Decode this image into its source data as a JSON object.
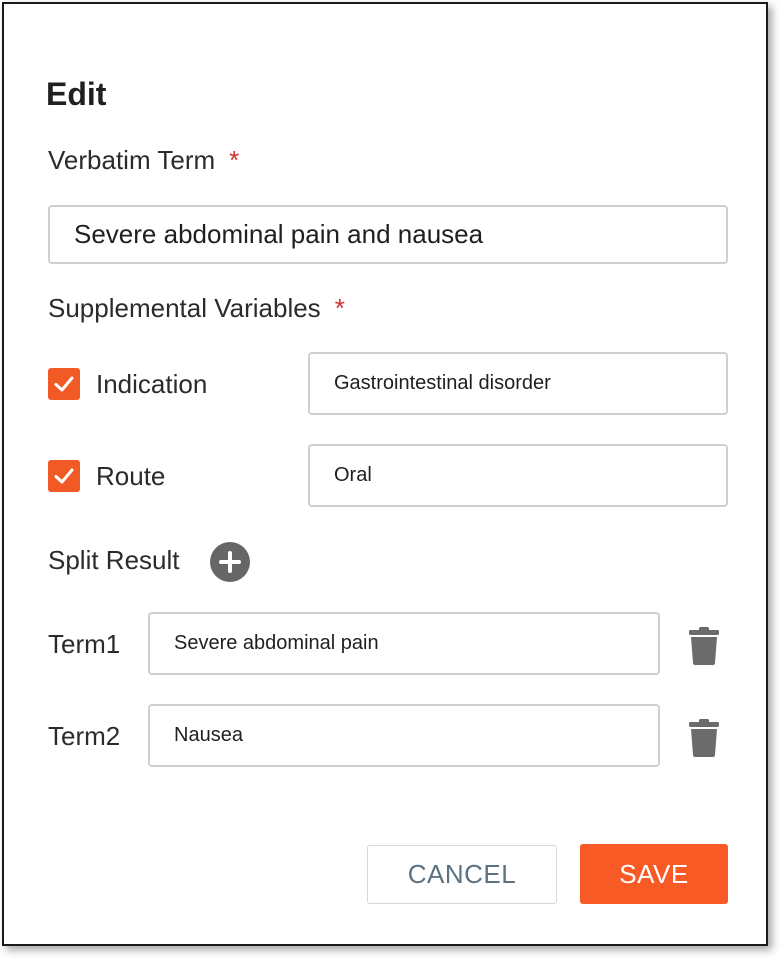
{
  "dialog": {
    "title": "Edit",
    "verbatim": {
      "label": "Verbatim Term",
      "required_mark": "*",
      "value": "Severe abdominal pain and nausea"
    },
    "supplemental": {
      "label": "Supplemental Variables",
      "required_mark": "*",
      "items": [
        {
          "label": "Indication",
          "checked": true,
          "value": "Gastrointestinal disorder"
        },
        {
          "label": "Route",
          "checked": true,
          "value": "Oral"
        }
      ]
    },
    "split": {
      "label": "Split Result",
      "terms": [
        {
          "label": "Term1",
          "value": "Severe abdominal pain"
        },
        {
          "label": "Term2",
          "value": "Nausea"
        }
      ]
    },
    "buttons": {
      "cancel": "CANCEL",
      "save": "SAVE"
    }
  },
  "colors": {
    "accent": "#f85a25",
    "checkbox": "#f15a24",
    "required": "#d32f2f",
    "icon": "#666666",
    "cancel_text": "#5d7384"
  },
  "icons": {
    "checkbox": "check-icon",
    "add": "plus-circle-icon",
    "delete": "trash-icon"
  }
}
